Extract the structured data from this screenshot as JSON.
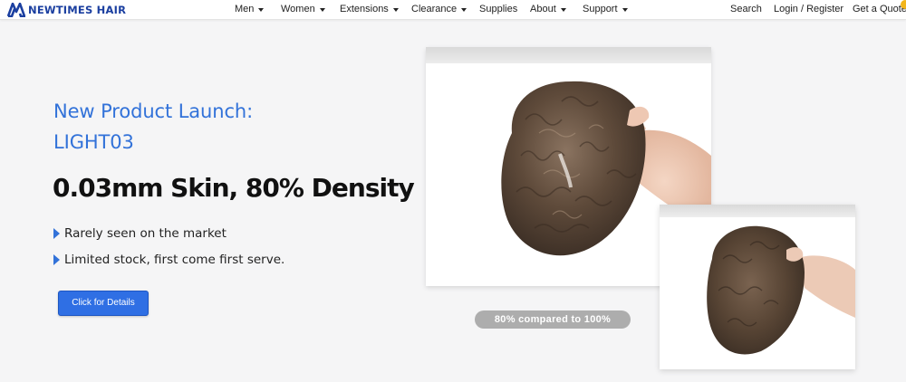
{
  "brand": {
    "name": "NEWTIMES HAIR",
    "color": "#1b3fa0"
  },
  "nav": {
    "items": [
      {
        "label": "Men",
        "has_dropdown": true
      },
      {
        "label": "Women",
        "has_dropdown": true
      },
      {
        "label": "Extensions",
        "has_dropdown": true
      },
      {
        "label": "Clearance",
        "has_dropdown": true
      },
      {
        "label": "Supplies",
        "has_dropdown": false
      },
      {
        "label": "About",
        "has_dropdown": true
      },
      {
        "label": "Support",
        "has_dropdown": true
      }
    ],
    "search": "Search",
    "login": "Login / Register",
    "quote": "Get a Quote"
  },
  "hero": {
    "title_line1": "New Product Launch:",
    "title_line2": "LIGHT03",
    "headline": "0.03mm Skin, 80% Density",
    "bullets": [
      "Rarely seen on the market",
      "Limited stock, first come first serve."
    ],
    "cta": "Click for Details",
    "accent": "#3272d9",
    "cta_color": "#2f6fe4"
  },
  "media": {
    "main_image_icon": "hair-system-photo-icon",
    "small_image_icon": "hair-system-photo-icon",
    "caption": "80% compared to 100%"
  }
}
